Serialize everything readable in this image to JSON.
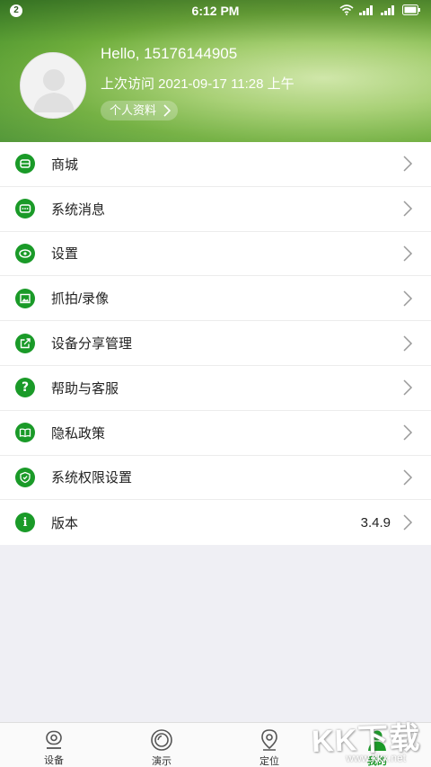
{
  "status_bar": {
    "badge": "2",
    "time": "6:12 PM"
  },
  "profile": {
    "hello": "Hello, 15176144905",
    "last_visit": "上次访问 2021-09-17 11:28 上午",
    "profile_button": "个人资料"
  },
  "menu": [
    {
      "label": "商城",
      "icon": "store-icon",
      "value": ""
    },
    {
      "label": "系统消息",
      "icon": "message-icon",
      "value": ""
    },
    {
      "label": "设置",
      "icon": "settings-eye-icon",
      "value": ""
    },
    {
      "label": "抓拍/录像",
      "icon": "image-icon",
      "value": ""
    },
    {
      "label": "设备分享管理",
      "icon": "share-icon",
      "value": ""
    },
    {
      "label": "帮助与客服",
      "icon": "help-icon",
      "value": ""
    },
    {
      "label": "隐私政策",
      "icon": "book-icon",
      "value": ""
    },
    {
      "label": "系统权限设置",
      "icon": "shield-icon",
      "value": ""
    },
    {
      "label": "版本",
      "icon": "info-icon",
      "value": "3.4.9"
    }
  ],
  "bottom_nav": [
    {
      "label": "设备",
      "icon": "camera-device-icon",
      "active": false
    },
    {
      "label": "演示",
      "icon": "demo-lens-icon",
      "active": false
    },
    {
      "label": "定位",
      "icon": "location-pin-icon",
      "active": false
    },
    {
      "label": "我的",
      "icon": "user-profile-icon",
      "active": true
    }
  ],
  "watermark": {
    "text": "KK下载",
    "url": "www.kkx.net"
  },
  "colors": {
    "accent": "#1a9a28",
    "header_green": "#6fae3c",
    "background": "#efeff4"
  }
}
